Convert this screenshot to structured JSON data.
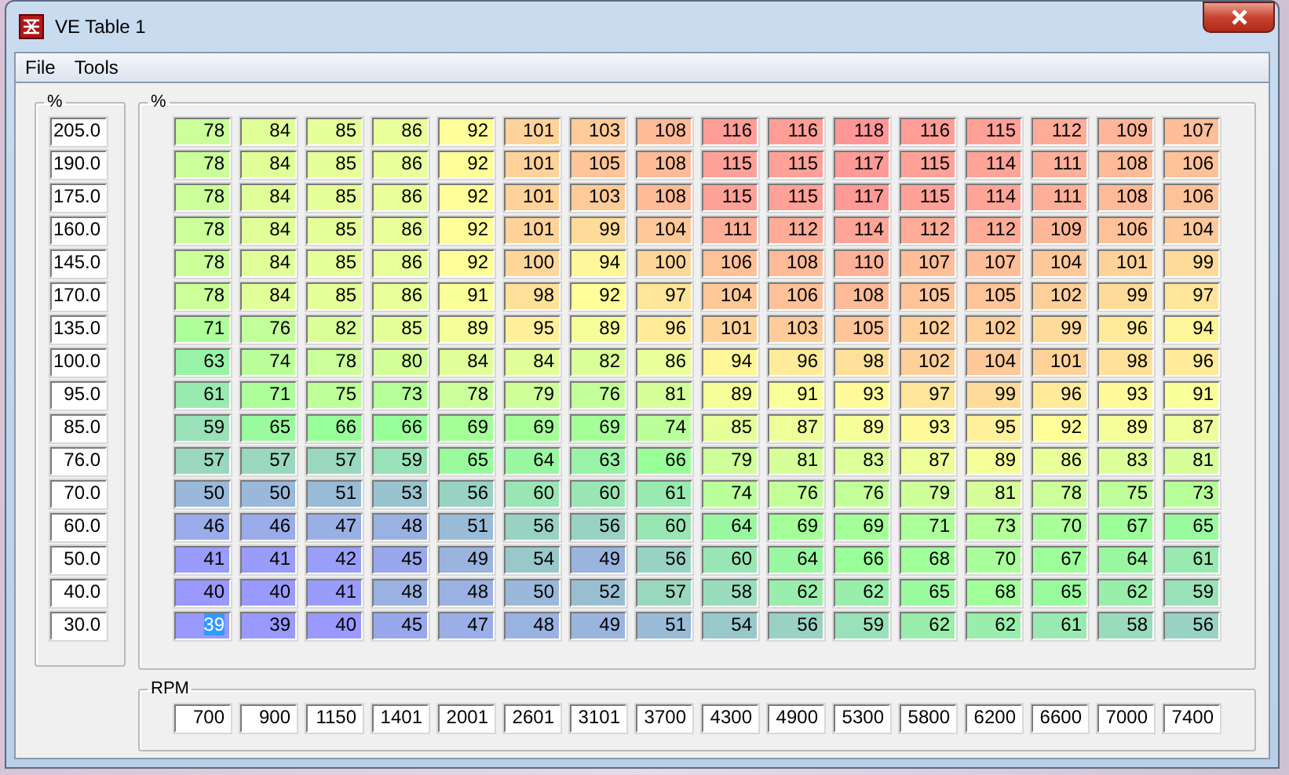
{
  "window": {
    "title": "VE Table 1"
  },
  "menu": [
    "File",
    "Tools"
  ],
  "row_axis": {
    "legend": "%"
  },
  "table": {
    "legend": "%",
    "rows": [
      {
        "label": "205.0",
        "cells": [
          {
            "value": "78",
            "selected": false
          },
          {
            "value": "84",
            "selected": false
          },
          {
            "value": "85",
            "selected": false
          },
          {
            "value": "86",
            "selected": false
          },
          {
            "value": "92",
            "selected": false
          },
          {
            "value": "101",
            "selected": false
          },
          {
            "value": "103",
            "selected": false
          },
          {
            "value": "108",
            "selected": false
          },
          {
            "value": "116",
            "selected": false
          },
          {
            "value": "116",
            "selected": false
          },
          {
            "value": "118",
            "selected": false
          },
          {
            "value": "116",
            "selected": false
          },
          {
            "value": "115",
            "selected": false
          },
          {
            "value": "112",
            "selected": false
          },
          {
            "value": "109",
            "selected": false
          },
          {
            "value": "107",
            "selected": false
          }
        ]
      },
      {
        "label": "190.0",
        "cells": [
          {
            "value": "78",
            "selected": false
          },
          {
            "value": "84",
            "selected": false
          },
          {
            "value": "85",
            "selected": false
          },
          {
            "value": "86",
            "selected": false
          },
          {
            "value": "92",
            "selected": false
          },
          {
            "value": "101",
            "selected": false
          },
          {
            "value": "105",
            "selected": false
          },
          {
            "value": "108",
            "selected": false
          },
          {
            "value": "115",
            "selected": false
          },
          {
            "value": "115",
            "selected": false
          },
          {
            "value": "117",
            "selected": false
          },
          {
            "value": "115",
            "selected": false
          },
          {
            "value": "114",
            "selected": false
          },
          {
            "value": "111",
            "selected": false
          },
          {
            "value": "108",
            "selected": false
          },
          {
            "value": "106",
            "selected": false
          }
        ]
      },
      {
        "label": "175.0",
        "cells": [
          {
            "value": "78",
            "selected": false
          },
          {
            "value": "84",
            "selected": false
          },
          {
            "value": "85",
            "selected": false
          },
          {
            "value": "86",
            "selected": false
          },
          {
            "value": "92",
            "selected": false
          },
          {
            "value": "101",
            "selected": false
          },
          {
            "value": "103",
            "selected": false
          },
          {
            "value": "108",
            "selected": false
          },
          {
            "value": "115",
            "selected": false
          },
          {
            "value": "115",
            "selected": false
          },
          {
            "value": "117",
            "selected": false
          },
          {
            "value": "115",
            "selected": false
          },
          {
            "value": "114",
            "selected": false
          },
          {
            "value": "111",
            "selected": false
          },
          {
            "value": "108",
            "selected": false
          },
          {
            "value": "106",
            "selected": false
          }
        ]
      },
      {
        "label": "160.0",
        "cells": [
          {
            "value": "78",
            "selected": false
          },
          {
            "value": "84",
            "selected": false
          },
          {
            "value": "85",
            "selected": false
          },
          {
            "value": "86",
            "selected": false
          },
          {
            "value": "92",
            "selected": false
          },
          {
            "value": "101",
            "selected": false
          },
          {
            "value": "99",
            "selected": false
          },
          {
            "value": "104",
            "selected": false
          },
          {
            "value": "111",
            "selected": false
          },
          {
            "value": "112",
            "selected": false
          },
          {
            "value": "114",
            "selected": false
          },
          {
            "value": "112",
            "selected": false
          },
          {
            "value": "112",
            "selected": false
          },
          {
            "value": "109",
            "selected": false
          },
          {
            "value": "106",
            "selected": false
          },
          {
            "value": "104",
            "selected": false
          }
        ]
      },
      {
        "label": "145.0",
        "cells": [
          {
            "value": "78",
            "selected": false
          },
          {
            "value": "84",
            "selected": false
          },
          {
            "value": "85",
            "selected": false
          },
          {
            "value": "86",
            "selected": false
          },
          {
            "value": "92",
            "selected": false
          },
          {
            "value": "100",
            "selected": false
          },
          {
            "value": "94",
            "selected": false
          },
          {
            "value": "100",
            "selected": false
          },
          {
            "value": "106",
            "selected": false
          },
          {
            "value": "108",
            "selected": false
          },
          {
            "value": "110",
            "selected": false
          },
          {
            "value": "107",
            "selected": false
          },
          {
            "value": "107",
            "selected": false
          },
          {
            "value": "104",
            "selected": false
          },
          {
            "value": "101",
            "selected": false
          },
          {
            "value": "99",
            "selected": false
          }
        ]
      },
      {
        "label": "170.0",
        "cells": [
          {
            "value": "78",
            "selected": false
          },
          {
            "value": "84",
            "selected": false
          },
          {
            "value": "85",
            "selected": false
          },
          {
            "value": "86",
            "selected": false
          },
          {
            "value": "91",
            "selected": false
          },
          {
            "value": "98",
            "selected": false
          },
          {
            "value": "92",
            "selected": false
          },
          {
            "value": "97",
            "selected": false
          },
          {
            "value": "104",
            "selected": false
          },
          {
            "value": "106",
            "selected": false
          },
          {
            "value": "108",
            "selected": false
          },
          {
            "value": "105",
            "selected": false
          },
          {
            "value": "105",
            "selected": false
          },
          {
            "value": "102",
            "selected": false
          },
          {
            "value": "99",
            "selected": false
          },
          {
            "value": "97",
            "selected": false
          }
        ]
      },
      {
        "label": "135.0",
        "cells": [
          {
            "value": "71",
            "selected": false
          },
          {
            "value": "76",
            "selected": false
          },
          {
            "value": "82",
            "selected": false
          },
          {
            "value": "85",
            "selected": false
          },
          {
            "value": "89",
            "selected": false
          },
          {
            "value": "95",
            "selected": false
          },
          {
            "value": "89",
            "selected": false
          },
          {
            "value": "96",
            "selected": false
          },
          {
            "value": "101",
            "selected": false
          },
          {
            "value": "103",
            "selected": false
          },
          {
            "value": "105",
            "selected": false
          },
          {
            "value": "102",
            "selected": false
          },
          {
            "value": "102",
            "selected": false
          },
          {
            "value": "99",
            "selected": false
          },
          {
            "value": "96",
            "selected": false
          },
          {
            "value": "94",
            "selected": false
          }
        ]
      },
      {
        "label": "100.0",
        "cells": [
          {
            "value": "63",
            "selected": false
          },
          {
            "value": "74",
            "selected": false
          },
          {
            "value": "78",
            "selected": false
          },
          {
            "value": "80",
            "selected": false
          },
          {
            "value": "84",
            "selected": false
          },
          {
            "value": "84",
            "selected": false
          },
          {
            "value": "82",
            "selected": false
          },
          {
            "value": "86",
            "selected": false
          },
          {
            "value": "94",
            "selected": false
          },
          {
            "value": "96",
            "selected": false
          },
          {
            "value": "98",
            "selected": false
          },
          {
            "value": "102",
            "selected": false
          },
          {
            "value": "104",
            "selected": false
          },
          {
            "value": "101",
            "selected": false
          },
          {
            "value": "98",
            "selected": false
          },
          {
            "value": "96",
            "selected": false
          }
        ]
      },
      {
        "label": "95.0",
        "cells": [
          {
            "value": "61",
            "selected": false
          },
          {
            "value": "71",
            "selected": false
          },
          {
            "value": "75",
            "selected": false
          },
          {
            "value": "73",
            "selected": false
          },
          {
            "value": "78",
            "selected": false
          },
          {
            "value": "79",
            "selected": false
          },
          {
            "value": "76",
            "selected": false
          },
          {
            "value": "81",
            "selected": false
          },
          {
            "value": "89",
            "selected": false
          },
          {
            "value": "91",
            "selected": false
          },
          {
            "value": "93",
            "selected": false
          },
          {
            "value": "97",
            "selected": false
          },
          {
            "value": "99",
            "selected": false
          },
          {
            "value": "96",
            "selected": false
          },
          {
            "value": "93",
            "selected": false
          },
          {
            "value": "91",
            "selected": false
          }
        ]
      },
      {
        "label": "85.0",
        "cells": [
          {
            "value": "59",
            "selected": false
          },
          {
            "value": "65",
            "selected": false
          },
          {
            "value": "66",
            "selected": false
          },
          {
            "value": "66",
            "selected": false
          },
          {
            "value": "69",
            "selected": false
          },
          {
            "value": "69",
            "selected": false
          },
          {
            "value": "69",
            "selected": false
          },
          {
            "value": "74",
            "selected": false
          },
          {
            "value": "85",
            "selected": false
          },
          {
            "value": "87",
            "selected": false
          },
          {
            "value": "89",
            "selected": false
          },
          {
            "value": "93",
            "selected": false
          },
          {
            "value": "95",
            "selected": false
          },
          {
            "value": "92",
            "selected": false
          },
          {
            "value": "89",
            "selected": false
          },
          {
            "value": "87",
            "selected": false
          }
        ]
      },
      {
        "label": "76.0",
        "cells": [
          {
            "value": "57",
            "selected": false
          },
          {
            "value": "57",
            "selected": false
          },
          {
            "value": "57",
            "selected": false
          },
          {
            "value": "59",
            "selected": false
          },
          {
            "value": "65",
            "selected": false
          },
          {
            "value": "64",
            "selected": false
          },
          {
            "value": "63",
            "selected": false
          },
          {
            "value": "66",
            "selected": false
          },
          {
            "value": "79",
            "selected": false
          },
          {
            "value": "81",
            "selected": false
          },
          {
            "value": "83",
            "selected": false
          },
          {
            "value": "87",
            "selected": false
          },
          {
            "value": "89",
            "selected": false
          },
          {
            "value": "86",
            "selected": false
          },
          {
            "value": "83",
            "selected": false
          },
          {
            "value": "81",
            "selected": false
          }
        ]
      },
      {
        "label": "70.0",
        "cells": [
          {
            "value": "50",
            "selected": false
          },
          {
            "value": "50",
            "selected": false
          },
          {
            "value": "51",
            "selected": false
          },
          {
            "value": "53",
            "selected": false
          },
          {
            "value": "56",
            "selected": false
          },
          {
            "value": "60",
            "selected": false
          },
          {
            "value": "60",
            "selected": false
          },
          {
            "value": "61",
            "selected": false
          },
          {
            "value": "74",
            "selected": false
          },
          {
            "value": "76",
            "selected": false
          },
          {
            "value": "76",
            "selected": false
          },
          {
            "value": "79",
            "selected": false
          },
          {
            "value": "81",
            "selected": false
          },
          {
            "value": "78",
            "selected": false
          },
          {
            "value": "75",
            "selected": false
          },
          {
            "value": "73",
            "selected": false
          }
        ]
      },
      {
        "label": "60.0",
        "cells": [
          {
            "value": "46",
            "selected": false
          },
          {
            "value": "46",
            "selected": false
          },
          {
            "value": "47",
            "selected": false
          },
          {
            "value": "48",
            "selected": false
          },
          {
            "value": "51",
            "selected": false
          },
          {
            "value": "56",
            "selected": false
          },
          {
            "value": "56",
            "selected": false
          },
          {
            "value": "60",
            "selected": false
          },
          {
            "value": "64",
            "selected": false
          },
          {
            "value": "69",
            "selected": false
          },
          {
            "value": "69",
            "selected": false
          },
          {
            "value": "71",
            "selected": false
          },
          {
            "value": "73",
            "selected": false
          },
          {
            "value": "70",
            "selected": false
          },
          {
            "value": "67",
            "selected": false
          },
          {
            "value": "65",
            "selected": false
          }
        ]
      },
      {
        "label": "50.0",
        "cells": [
          {
            "value": "41",
            "selected": false
          },
          {
            "value": "41",
            "selected": false
          },
          {
            "value": "42",
            "selected": false
          },
          {
            "value": "45",
            "selected": false
          },
          {
            "value": "49",
            "selected": false
          },
          {
            "value": "54",
            "selected": false
          },
          {
            "value": "49",
            "selected": false
          },
          {
            "value": "56",
            "selected": false
          },
          {
            "value": "60",
            "selected": false
          },
          {
            "value": "64",
            "selected": false
          },
          {
            "value": "66",
            "selected": false
          },
          {
            "value": "68",
            "selected": false
          },
          {
            "value": "70",
            "selected": false
          },
          {
            "value": "67",
            "selected": false
          },
          {
            "value": "64",
            "selected": false
          },
          {
            "value": "61",
            "selected": false
          }
        ]
      },
      {
        "label": "40.0",
        "cells": [
          {
            "value": "40",
            "selected": false
          },
          {
            "value": "40",
            "selected": false
          },
          {
            "value": "41",
            "selected": false
          },
          {
            "value": "48",
            "selected": false
          },
          {
            "value": "48",
            "selected": false
          },
          {
            "value": "50",
            "selected": false
          },
          {
            "value": "52",
            "selected": false
          },
          {
            "value": "57",
            "selected": false
          },
          {
            "value": "58",
            "selected": false
          },
          {
            "value": "62",
            "selected": false
          },
          {
            "value": "62",
            "selected": false
          },
          {
            "value": "65",
            "selected": false
          },
          {
            "value": "68",
            "selected": false
          },
          {
            "value": "65",
            "selected": false
          },
          {
            "value": "62",
            "selected": false
          },
          {
            "value": "59",
            "selected": false
          }
        ]
      },
      {
        "label": "30.0",
        "cells": [
          {
            "value": "39",
            "selected": true
          },
          {
            "value": "39",
            "selected": false
          },
          {
            "value": "40",
            "selected": false
          },
          {
            "value": "45",
            "selected": false
          },
          {
            "value": "47",
            "selected": false
          },
          {
            "value": "48",
            "selected": false
          },
          {
            "value": "49",
            "selected": false
          },
          {
            "value": "51",
            "selected": false
          },
          {
            "value": "54",
            "selected": false
          },
          {
            "value": "56",
            "selected": false
          },
          {
            "value": "59",
            "selected": false
          },
          {
            "value": "62",
            "selected": false
          },
          {
            "value": "62",
            "selected": false
          },
          {
            "value": "61",
            "selected": false
          },
          {
            "value": "58",
            "selected": false
          },
          {
            "value": "56",
            "selected": false
          }
        ]
      }
    ]
  },
  "rpm_axis": {
    "legend": "RPM",
    "values": [
      "700",
      "900",
      "1150",
      "1401",
      "2001",
      "2601",
      "3101",
      "3700",
      "4300",
      "4900",
      "5300",
      "5800",
      "6200",
      "6600",
      "7000",
      "7400"
    ]
  }
}
